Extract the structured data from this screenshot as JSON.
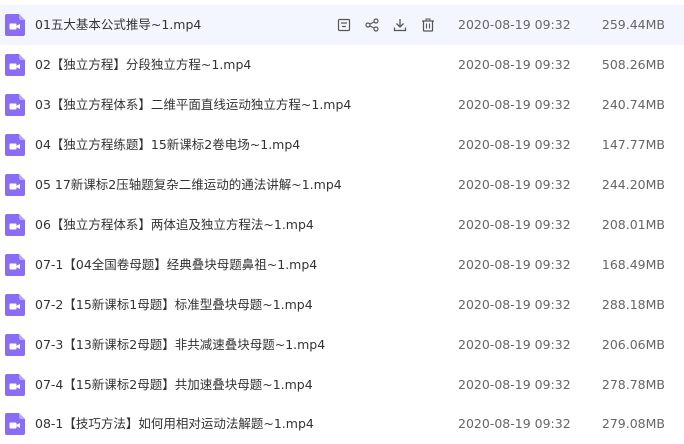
{
  "colors": {
    "video_icon": "#8a6cf5",
    "hover_row": "#f4f6ff",
    "action_icon": "#555555"
  },
  "row_actions": {
    "icons": [
      "save-to-drive-icon",
      "share-icon",
      "download-icon",
      "delete-icon"
    ]
  },
  "files": [
    {
      "name": "01五大基本公式推导~1.mp4",
      "date": "2020-08-19 09:32",
      "size": "259.44MB",
      "icon": "video-file-icon"
    },
    {
      "name": "02【独立方程】分段独立方程~1.mp4",
      "date": "2020-08-19 09:32",
      "size": "508.26MB",
      "icon": "video-file-icon"
    },
    {
      "name": "03【独立方程体系】二维平面直线运动独立方程~1.mp4",
      "date": "2020-08-19 09:32",
      "size": "240.74MB",
      "icon": "video-file-icon"
    },
    {
      "name": "04【独立方程练题】15新课标2卷电场~1.mp4",
      "date": "2020-08-19 09:32",
      "size": "147.77MB",
      "icon": "video-file-icon"
    },
    {
      "name": "05 17新课标2压轴题复杂二维运动的通法讲解~1.mp4",
      "date": "2020-08-19 09:32",
      "size": "244.20MB",
      "icon": "video-file-icon"
    },
    {
      "name": "06【独立方程体系】两体追及独立方程法~1.mp4",
      "date": "2020-08-19 09:32",
      "size": "208.01MB",
      "icon": "video-file-icon"
    },
    {
      "name": "07-1【04全国卷母题】经典叠块母题鼻祖~1.mp4",
      "date": "2020-08-19 09:32",
      "size": "168.49MB",
      "icon": "video-file-icon"
    },
    {
      "name": "07-2【15新课标1母题】标准型叠块母题~1.mp4",
      "date": "2020-08-19 09:32",
      "size": "288.18MB",
      "icon": "video-file-icon"
    },
    {
      "name": "07-3【13新课标2母题】非共减速叠块母题~1.mp4",
      "date": "2020-08-19 09:32",
      "size": "206.06MB",
      "icon": "video-file-icon"
    },
    {
      "name": "07-4【15新课标2母题】共加速叠块母题~1.mp4",
      "date": "2020-08-19 09:32",
      "size": "278.78MB",
      "icon": "video-file-icon"
    },
    {
      "name": "08-1【技巧方法】如何用相对运动法解题~1.mp4",
      "date": "2020-08-19 09:32",
      "size": "279.08MB",
      "icon": "video-file-icon"
    }
  ]
}
